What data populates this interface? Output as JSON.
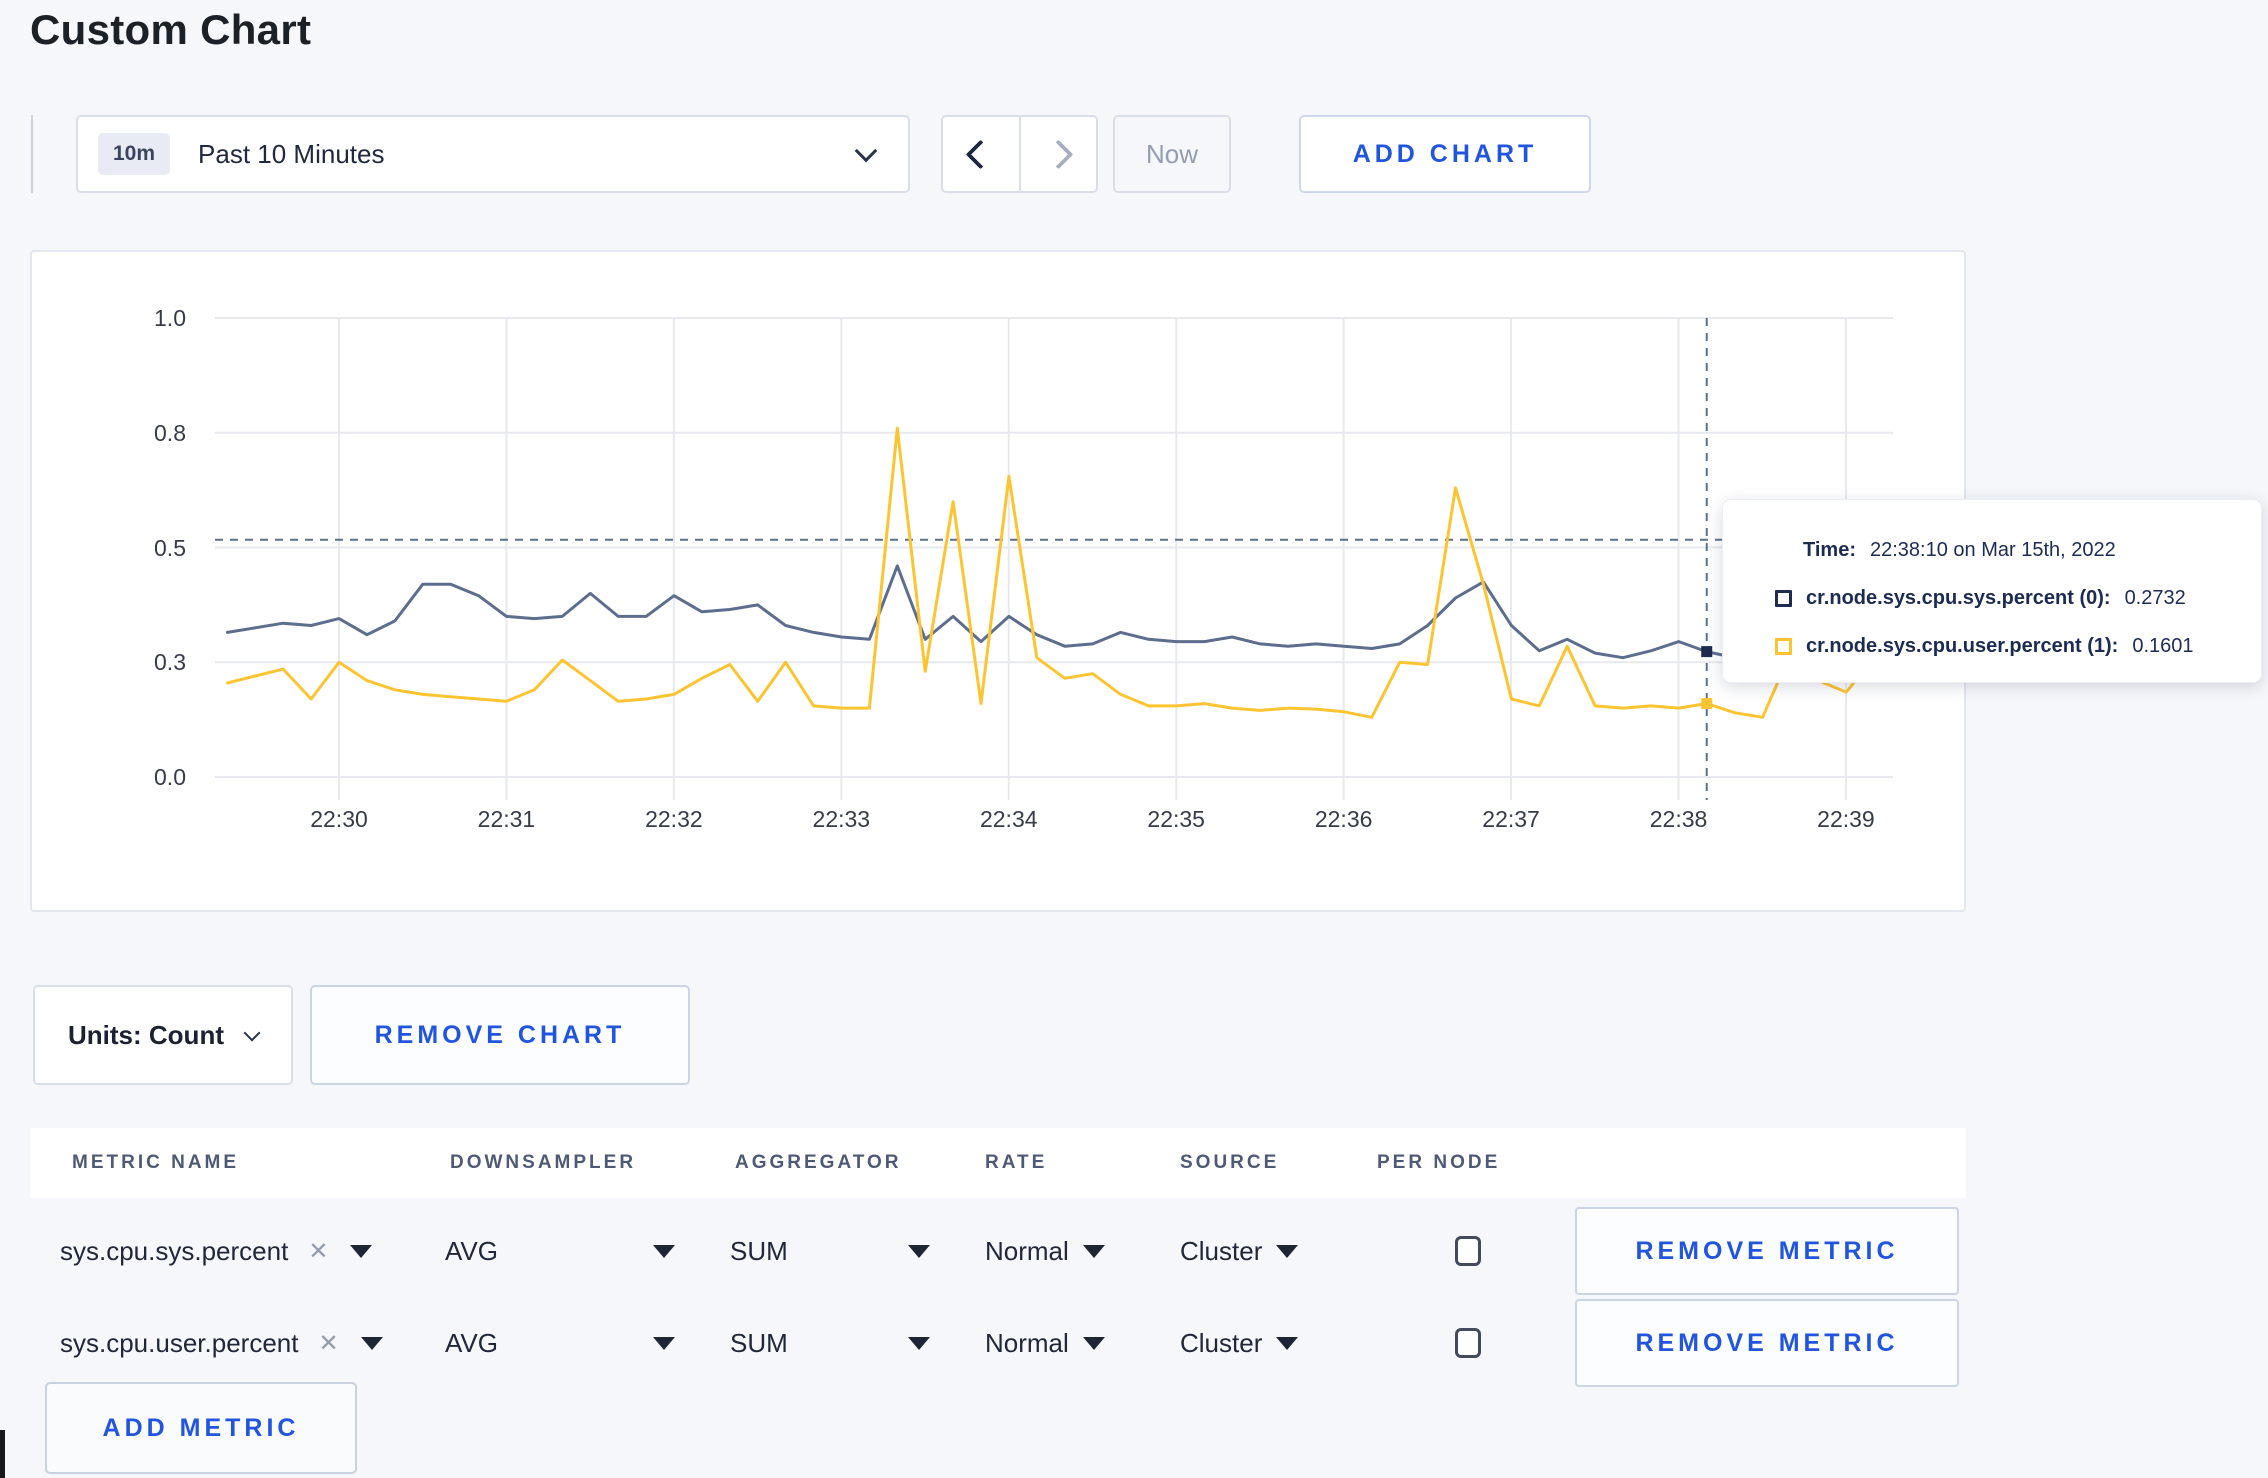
{
  "page": {
    "title": "Custom Chart",
    "accent_blue": "#2155df",
    "background": "#f6f7fa"
  },
  "toolbar": {
    "time_window_badge": "10m",
    "time_window_label": "Past 10 Minutes",
    "now_label": "Now",
    "add_chart_label": "ADD CHART"
  },
  "chart_data": {
    "type": "line",
    "title": "",
    "xlabel": "",
    "ylabel": "",
    "ylim": [
      0,
      1.0
    ],
    "grid": true,
    "x_start": "22:29:20",
    "x_end": "22:39:10",
    "x_interval_seconds": 10,
    "x_tick_labels": [
      "22:30",
      "22:31",
      "22:32",
      "22:33",
      "22:34",
      "22:35",
      "22:36",
      "22:37",
      "22:38",
      "22:39"
    ],
    "y_tick_labels": [
      "1.0",
      "0.8",
      "0.5",
      "0.3",
      "0.0"
    ],
    "y_tick_values": [
      1.0,
      0.75,
      0.5,
      0.25,
      0.0
    ],
    "series": [
      {
        "name": "cr.node.sys.cpu.sys.percent",
        "color": "#5d6d8d",
        "values": [
          0.315,
          0.325,
          0.335,
          0.33,
          0.345,
          0.31,
          0.34,
          0.42,
          0.42,
          0.395,
          0.35,
          0.345,
          0.35,
          0.4,
          0.35,
          0.35,
          0.395,
          0.36,
          0.365,
          0.375,
          0.33,
          0.315,
          0.305,
          0.3,
          0.46,
          0.3,
          0.35,
          0.295,
          0.35,
          0.31,
          0.285,
          0.29,
          0.315,
          0.3,
          0.295,
          0.295,
          0.305,
          0.29,
          0.285,
          0.29,
          0.285,
          0.28,
          0.29,
          0.33,
          0.39,
          0.425,
          0.33,
          0.275,
          0.3,
          0.27,
          0.26,
          0.275,
          0.295,
          0.2732,
          0.26,
          0.27,
          0.28,
          0.29,
          0.3,
          0.3
        ]
      },
      {
        "name": "cr.node.sys.cpu.user.percent",
        "color": "#fdc432",
        "values": [
          0.205,
          0.22,
          0.235,
          0.17,
          0.25,
          0.21,
          0.19,
          0.18,
          0.175,
          0.17,
          0.165,
          0.19,
          0.255,
          0.21,
          0.165,
          0.17,
          0.18,
          0.215,
          0.245,
          0.165,
          0.25,
          0.155,
          0.15,
          0.15,
          0.76,
          0.23,
          0.6,
          0.16,
          0.655,
          0.26,
          0.215,
          0.225,
          0.18,
          0.155,
          0.155,
          0.16,
          0.15,
          0.145,
          0.15,
          0.148,
          0.142,
          0.13,
          0.25,
          0.245,
          0.63,
          0.42,
          0.17,
          0.155,
          0.285,
          0.155,
          0.15,
          0.155,
          0.15,
          0.1601,
          0.14,
          0.13,
          0.27,
          0.21,
          0.185,
          0.26
        ]
      }
    ],
    "crosshair": {
      "x_index": 53,
      "x_time": "22:38:10",
      "y_value": 0.517
    },
    "legend_position": "tooltip"
  },
  "tooltip": {
    "time_label": "Time:",
    "time_value": "22:38:10 on Mar 15th, 2022",
    "entries": [
      {
        "label": "cr.node.sys.cpu.sys.percent (0):",
        "value": "0.2732",
        "color": "#1e2c4f"
      },
      {
        "label": "cr.node.sys.cpu.user.percent (1):",
        "value": "0.1601",
        "color": "#fdc432"
      }
    ]
  },
  "chart_footer": {
    "units_label": "Units: Count",
    "remove_chart_label": "REMOVE CHART"
  },
  "metrics_table": {
    "headers": [
      "METRIC NAME",
      "DOWNSAMPLER",
      "AGGREGATOR",
      "RATE",
      "SOURCE",
      "PER NODE"
    ],
    "rows": [
      {
        "metric_name": "sys.cpu.sys.percent",
        "remove_icon": "✕",
        "downsampler": "AVG",
        "aggregator": "SUM",
        "rate": "Normal",
        "source": "Cluster",
        "per_node_checked": false,
        "remove_label": "REMOVE METRIC"
      },
      {
        "metric_name": "sys.cpu.user.percent",
        "remove_icon": "✕",
        "downsampler": "AVG",
        "aggregator": "SUM",
        "rate": "Normal",
        "source": "Cluster",
        "per_node_checked": false,
        "remove_label": "REMOVE METRIC"
      }
    ],
    "add_metric_label": "ADD METRIC"
  }
}
